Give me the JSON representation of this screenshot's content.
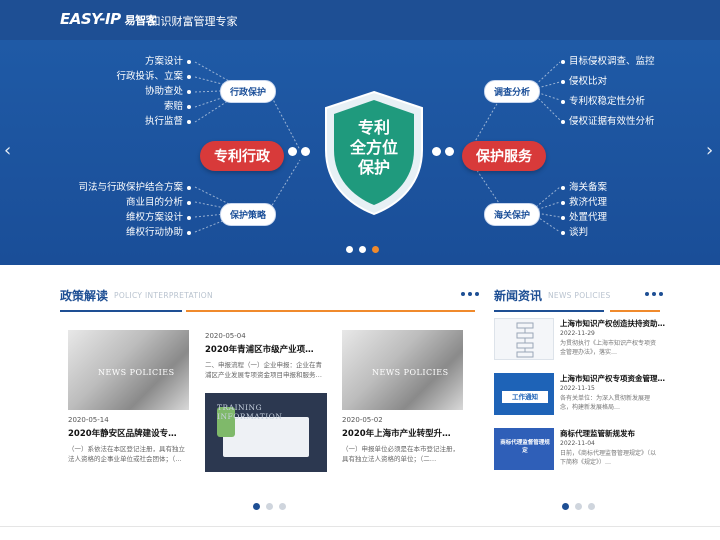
{
  "header": {
    "logo": "EASY-IP",
    "logo_sub": "易智客",
    "slogan": "- 知识财富管理专家"
  },
  "hero": {
    "left_top_items": [
      "方案设计",
      "行政投诉、立案",
      "协助查处",
      "索赔",
      "执行监督"
    ],
    "left_bottom_items": [
      "司法与行政保护结合方案",
      "商业目的分析",
      "维权方案设计",
      "维权行动协助"
    ],
    "right_top_items": [
      "目标侵权调查、监控",
      "侵权比对",
      "专利权稳定性分析",
      "侵权证据有效性分析"
    ],
    "right_bottom_items": [
      "海关备案",
      "救济代理",
      "处置代理",
      "谈判"
    ],
    "pill_admin": "行政保护",
    "pill_strategy": "保护策略",
    "pill_investigate": "调查分析",
    "pill_customs": "海关保护",
    "red_left": "专利行政",
    "red_right": "保护服务",
    "shield_lines": [
      "专利",
      "全方位",
      "保护"
    ],
    "prev_arrow": "‹",
    "next_arrow": "›",
    "accent": "#f08a2c",
    "bg": "#1a4e98"
  },
  "policy": {
    "title": "政策解读",
    "title_en": "POLICY INTERPRETATION",
    "cards": [
      {
        "date": "2020-05-14",
        "title": "2020年静安区品牌建设专…",
        "desc": "（一）系依法在本区登记注册，具有独立法人资格的企事业单位或社会团体；（…",
        "img_label": "NEWS POLICIES"
      },
      {
        "date": "2020-05-04",
        "title": "2020年青浦区市级产业项…",
        "desc": "二、申报流程（一）企业申报：企业在青浦区产业发展专项资金项目申报和服务…",
        "img_label": "TRAINING INFORMATION"
      },
      {
        "date": "2020-05-02",
        "title": "2020年上海市产业转型升…",
        "desc": "（一）申报单位必须是在本市登记注册，具有独立法人资格的单位；（二…",
        "img_label": "NEWS POLICIES"
      }
    ]
  },
  "news": {
    "title": "新闻资讯",
    "title_en": "NEWS POLICIES",
    "items": [
      {
        "title": "上海市知识产权创造扶持资助…",
        "date": "2022-11-29",
        "summary": "为贯彻执行《上海市知识产权专项资金管理办法》，落实…"
      },
      {
        "title": "上海市知识产权专项资金管理…",
        "date": "2022-11-15",
        "summary": "各有关单位：为深入贯彻新发展理念，构建新发展格局…",
        "thumb_text": "工作通知"
      },
      {
        "title": "商标代理监管新规发布",
        "date": "2022-11-04",
        "summary": "日前，《商标代理监督管理规定》（以下简称《规定》）…",
        "thumb_text": "商标代理监督管理规定"
      }
    ]
  }
}
